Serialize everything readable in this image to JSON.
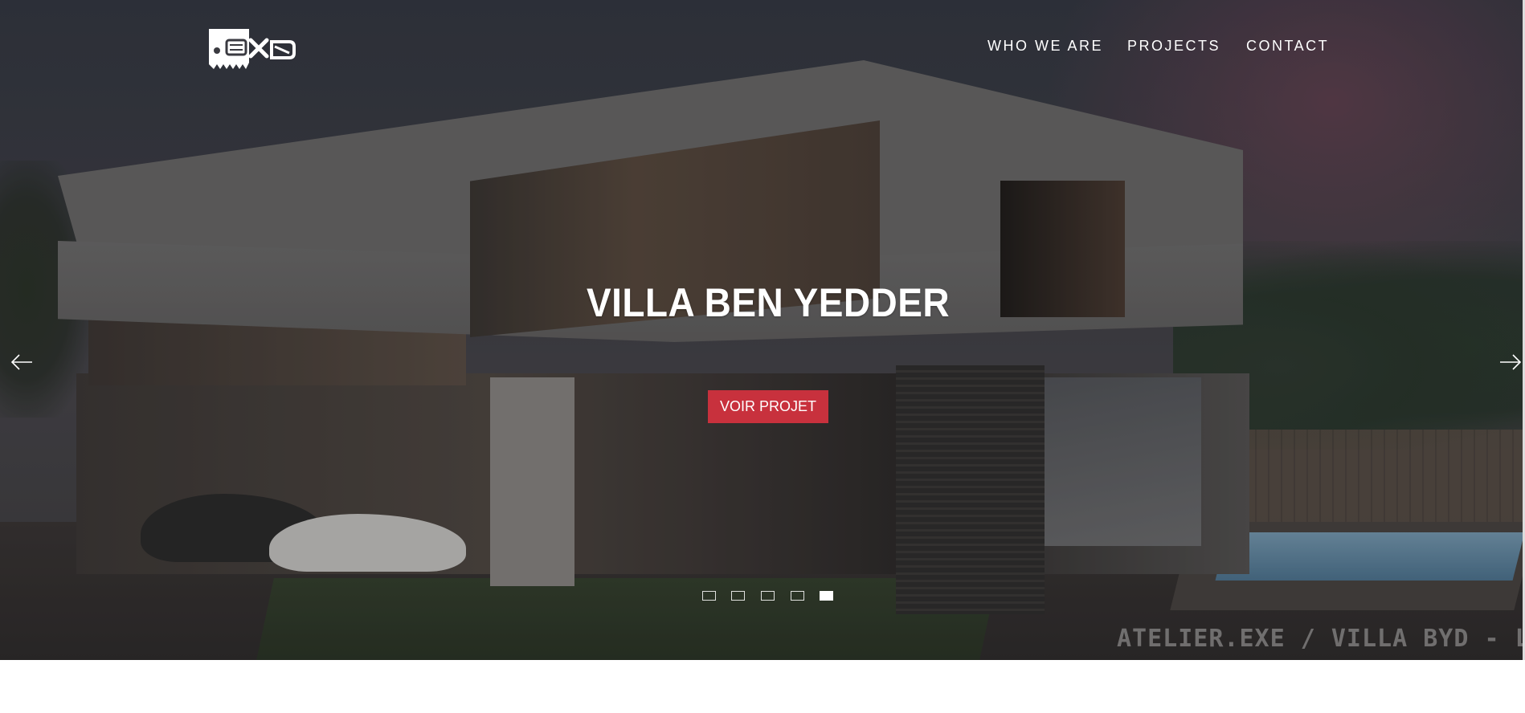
{
  "nav": {
    "items": [
      {
        "label": "WHO WE ARE"
      },
      {
        "label": "PROJECTS"
      },
      {
        "label": "CONTACT"
      }
    ]
  },
  "hero": {
    "title": "VILLA BEN YEDDER",
    "cta_label": "VOIR PROJET",
    "watermark": "ATELIER.EXE / VILLA BYD - LA SOUK",
    "active_slide_index": 4,
    "slide_count": 5
  },
  "colors": {
    "accent": "#c8313d",
    "text": "#ffffff"
  },
  "icons": {
    "prev": "arrow-left-icon",
    "next": "arrow-right-icon",
    "logo": "exe-logo"
  }
}
